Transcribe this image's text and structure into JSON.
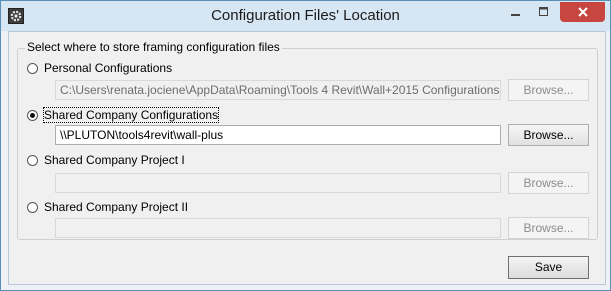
{
  "window": {
    "title": "Configuration Files' Location",
    "icon": "gear-icon",
    "controls": {
      "minimize": "minimize-icon",
      "maximize": "maximize-icon",
      "close": "close-icon"
    },
    "accent": "#c7463f"
  },
  "group": {
    "title": "Select where to store framing configuration files"
  },
  "options": [
    {
      "label": "Personal Configurations",
      "selected": false,
      "path": "C:\\Users\\renata.jociene\\AppData\\Roaming\\Tools 4 Revit\\Wall+2015 Configurations",
      "browse": "Browse...",
      "enabled": false
    },
    {
      "label": "Shared Company Configurations",
      "selected": true,
      "path": "\\\\PLUTON\\tools4revit\\wall-plus",
      "browse": "Browse...",
      "enabled": true
    },
    {
      "label": "Shared Company Project I",
      "selected": false,
      "path": "",
      "browse": "Browse...",
      "enabled": false
    },
    {
      "label": "Shared Company Project II",
      "selected": false,
      "path": "",
      "browse": "Browse...",
      "enabled": false
    }
  ],
  "footer": {
    "save_label": "Save"
  }
}
